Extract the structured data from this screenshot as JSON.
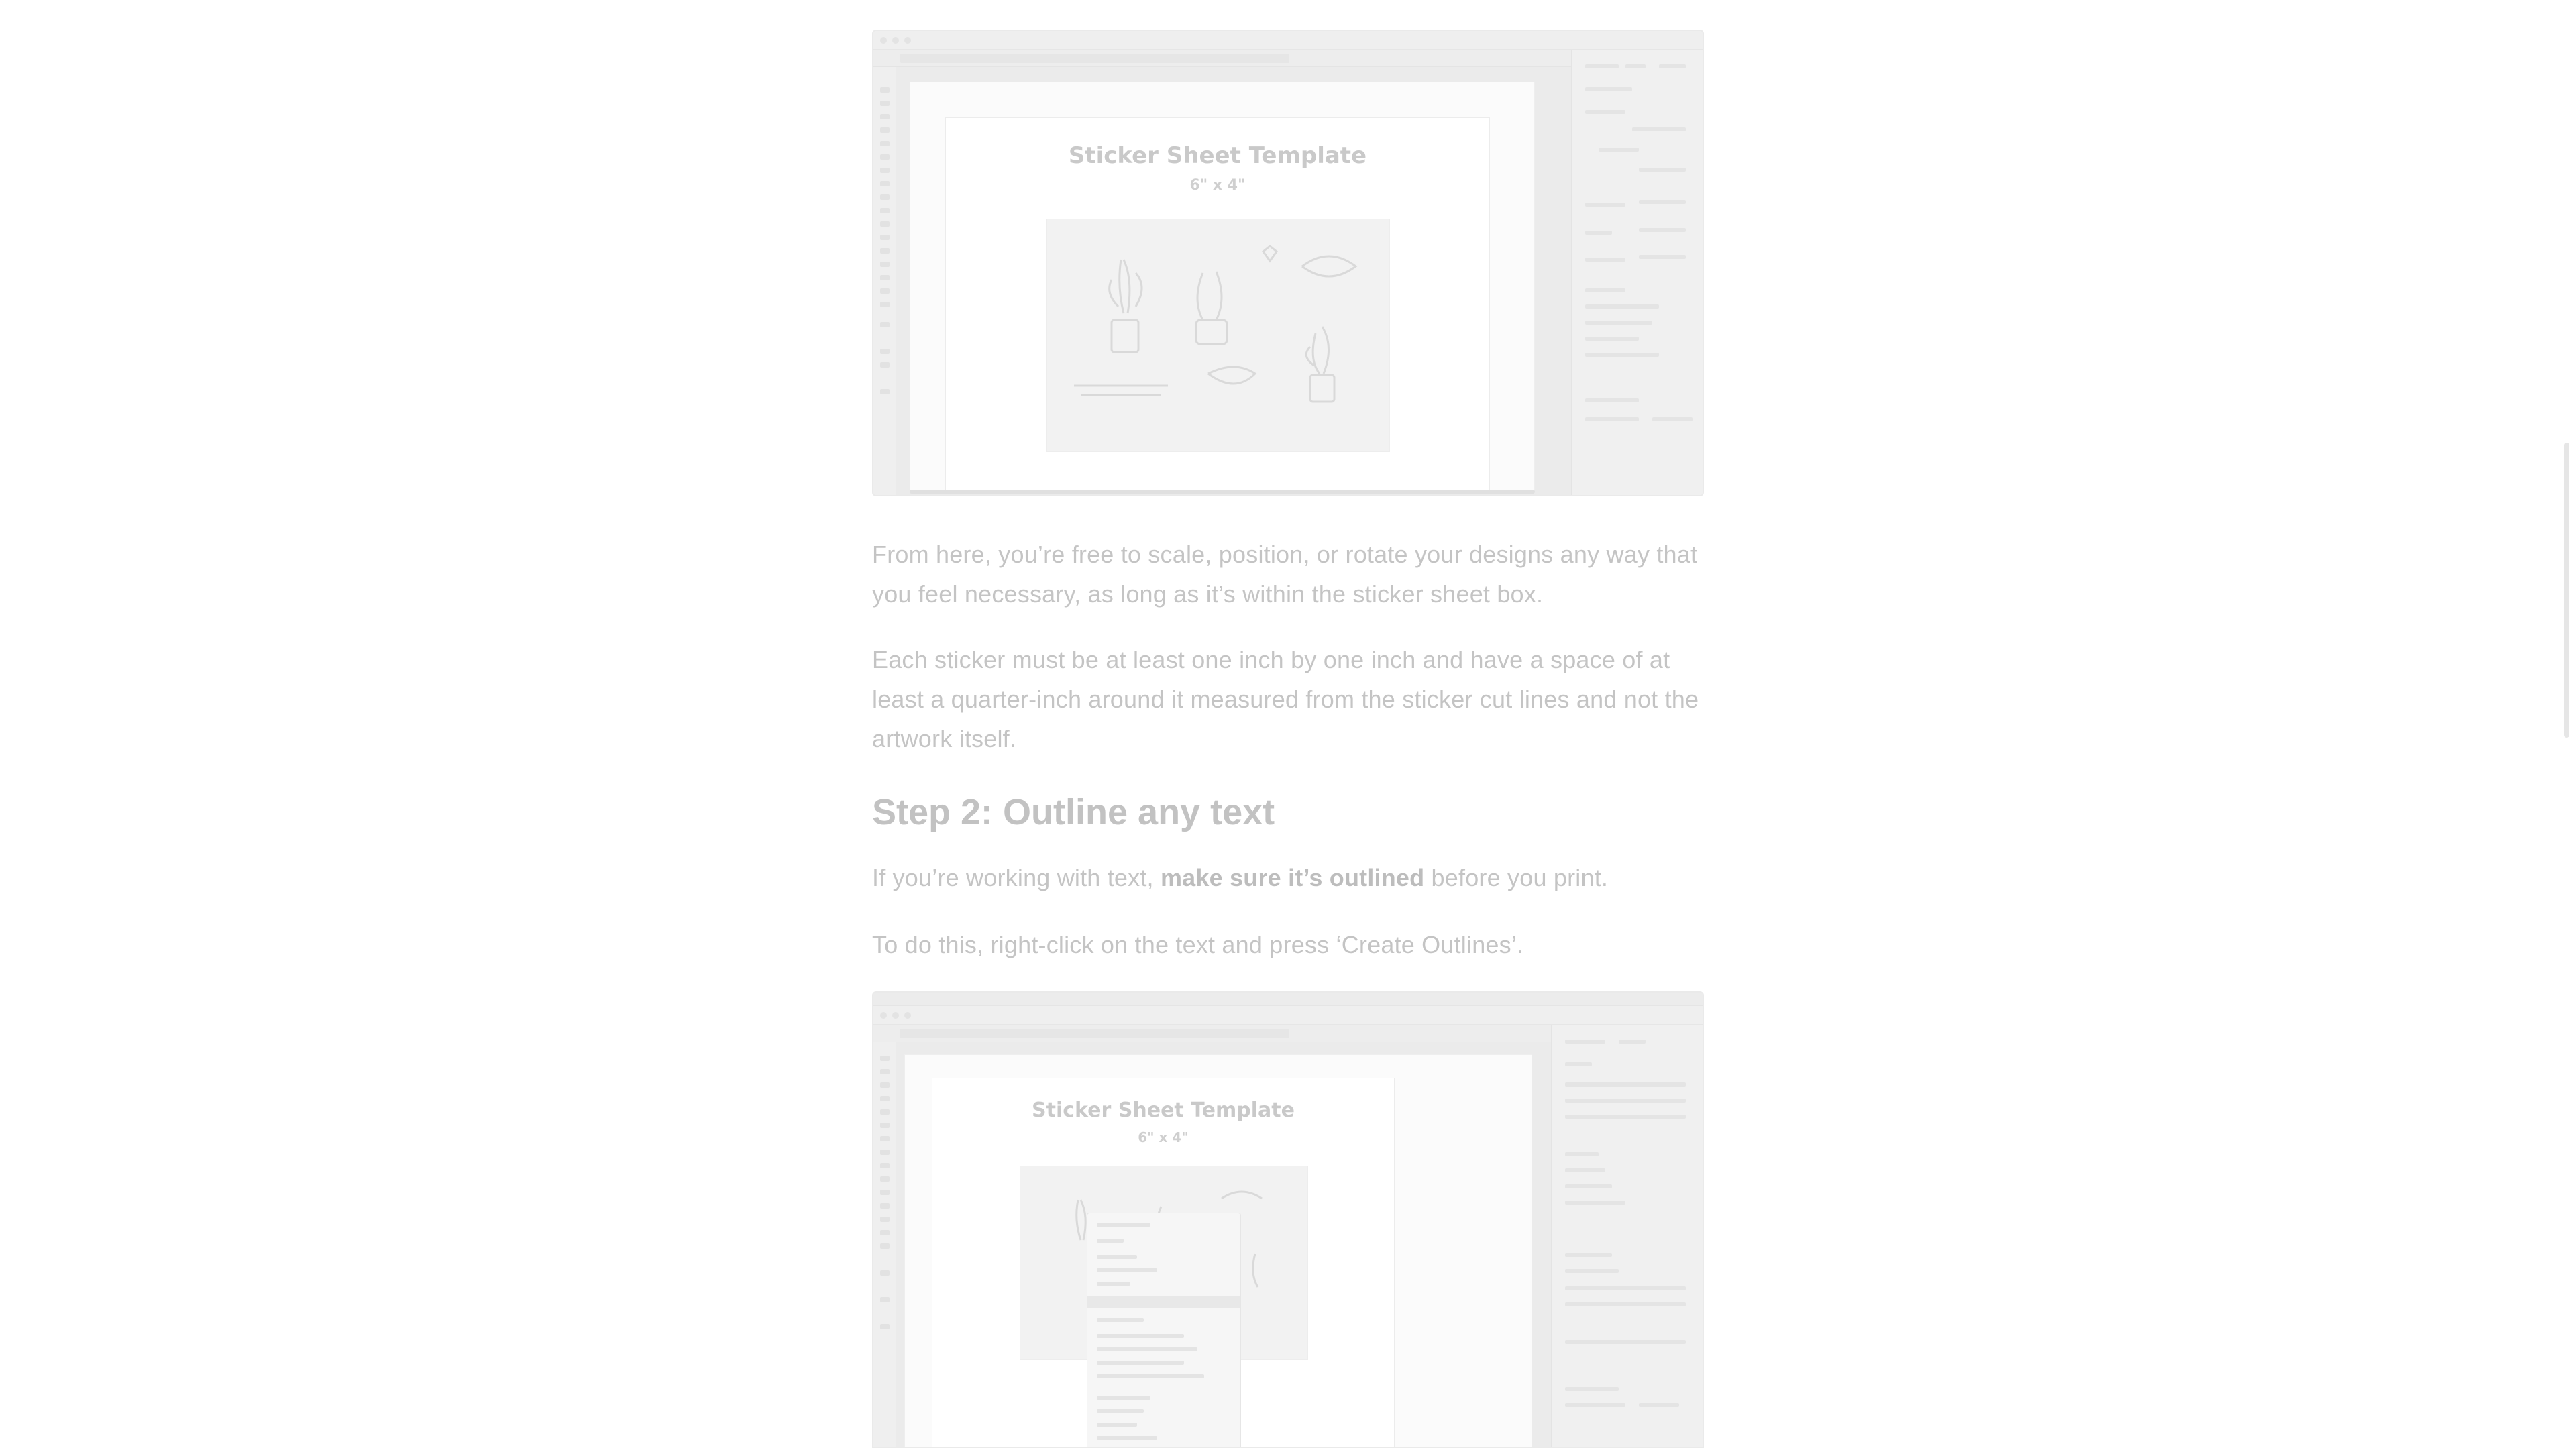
{
  "shot1": {
    "template_title": "Sticker Sheet Template",
    "template_size": "6\" x 4\""
  },
  "paragraphs": {
    "p1": "From here, you’re free to scale, position, or rotate your designs any way that you feel necessary, as long as it’s within the sticker sheet box.",
    "p2": "Each sticker must be at least one inch by one inch and have a space of at least a quarter-inch around it measured from the sticker cut lines and not the artwork itself."
  },
  "step2": {
    "heading": "Step 2: Outline any text",
    "p3_before": "If you’re working with text, ",
    "p3_bold": "make sure it’s outlined",
    "p3_after": " before you print.",
    "p4": "To do this, right-click on the text and press ‘Create Outlines’."
  },
  "shot2": {
    "template_title": "Sticker Sheet Template",
    "template_size": "6\" x 4\""
  },
  "colors": {
    "text": "#c4c4c4",
    "heading": "#c2c2c2",
    "frame": "#f4f4f4"
  }
}
